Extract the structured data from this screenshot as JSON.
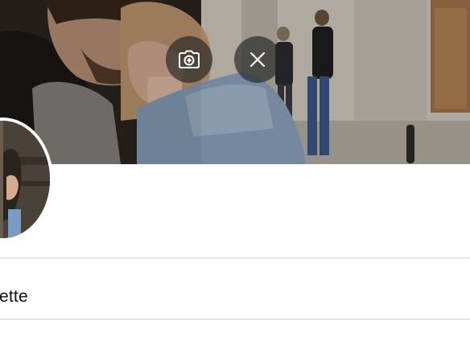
{
  "cover": {
    "photo": "couple-street-photo",
    "actions": {
      "change_photo_icon": "camera-plus-icon",
      "remove_photo_icon": "close-icon"
    }
  },
  "profile": {
    "avatar": "profile-photo",
    "name_value": "ette"
  },
  "colors": {
    "overlay_button": "#282828",
    "divider": "#d4d4d4",
    "text": "#111111"
  }
}
